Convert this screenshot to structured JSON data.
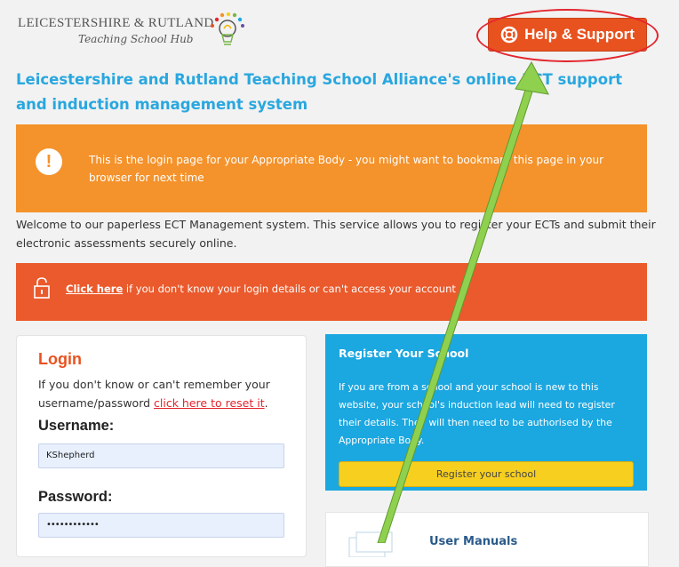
{
  "brand": {
    "line1": "LEICESTERSHIRE & RUTLAND",
    "line2": "Teaching School Hub"
  },
  "header": {
    "help_label": "Help & Support"
  },
  "page": {
    "title": "Leicestershire and Rutland Teaching School Alliance's online ECT support and induction management system"
  },
  "notice_orange": {
    "text": "This is the login page for your Appropriate Body - you might want to bookmark this page in your browser for next time"
  },
  "welcome": {
    "text": "Welcome to our paperless ECT Management system. This service allows you to register your ECTs and submit their electronic assessments securely online."
  },
  "notice_red": {
    "link": "Click here",
    "text": " if you don't know your login details or can't access your account"
  },
  "login": {
    "title": "Login",
    "help_text": "If you don't know or can't remember your username/password ",
    "reset_link": "click here to reset it",
    "help_end": ".",
    "username_label": "Username:",
    "username_value": "KShepherd",
    "password_label": "Password:",
    "password_value": "••••••••••••"
  },
  "register": {
    "title": "Register Your School",
    "text": "If you are from a school and your school is new to this website, your school's induction lead will need to register their details. They will then need to be authorised by the Appropriate Body.",
    "button": "Register your school"
  },
  "manuals": {
    "title": "User Manuals"
  },
  "colors": {
    "accent_blue": "#29a7df",
    "help_orange": "#e8521f",
    "notice_orange": "#f4922b",
    "notice_red": "#ea5a2c",
    "register_blue": "#1ba7e0",
    "register_yellow": "#f7cf1f",
    "annotation_red": "#e3262e",
    "annotation_green": "#8fd14f"
  },
  "icons": [
    "lightbulb-icon",
    "lifebuoy-icon",
    "exclamation-icon",
    "lock-icon",
    "manual-icon"
  ]
}
